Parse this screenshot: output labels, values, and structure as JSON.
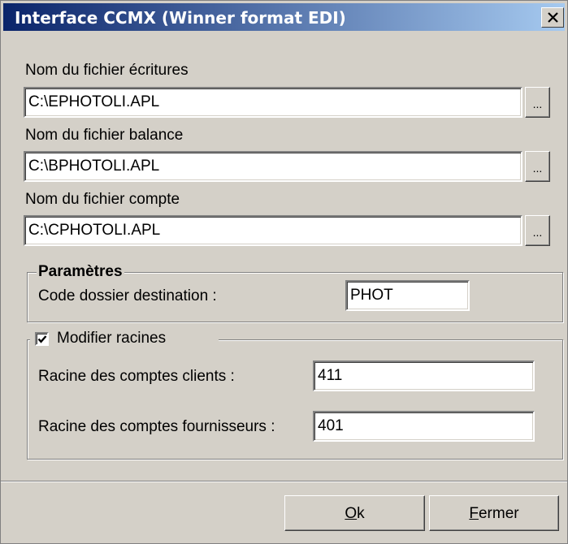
{
  "window": {
    "title": "Interface CCMX (Winner format EDI)",
    "close_icon": "close-x-icon"
  },
  "files": [
    {
      "label": "Nom du fichier écritures",
      "value": "C:\\EPHOTOLI.APL",
      "browse": "..."
    },
    {
      "label": "Nom du fichier balance",
      "value": "C:\\BPHOTOLI.APL",
      "browse": "..."
    },
    {
      "label": "Nom du fichier compte",
      "value": "C:\\CPHOTOLI.APL",
      "browse": "..."
    }
  ],
  "parametres": {
    "legend": "Paramètres",
    "code_label": "Code dossier destination :",
    "code_value": "PHOT"
  },
  "racines": {
    "checkbox_label": "Modifier racines",
    "checked": true,
    "clients_label": "Racine des comptes clients :",
    "clients_value": "411",
    "fournisseurs_label": "Racine des comptes fournisseurs :",
    "fournisseurs_value": "401"
  },
  "buttons": {
    "ok_mnemonic": "O",
    "ok_rest": "k",
    "fermer_mnemonic": "F",
    "fermer_rest": "ermer"
  },
  "colors": {
    "titlebar_start": "#0a246a",
    "titlebar_end": "#a6caf0",
    "face": "#d4d0c8"
  }
}
